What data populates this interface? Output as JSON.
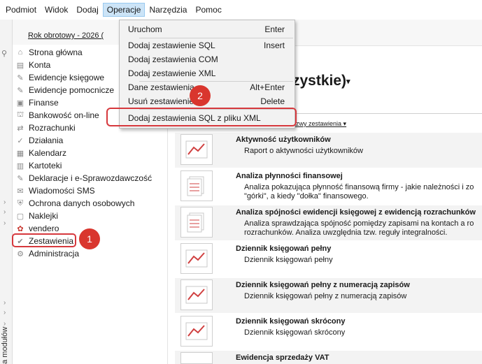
{
  "menubar": {
    "items": [
      "Podmiot",
      "Widok",
      "Dodaj",
      "Operacje",
      "Narzędzia",
      "Pomoc"
    ],
    "active_index": 3
  },
  "top": {
    "rok_label": "Rok obrotowy - 2026  ("
  },
  "left_strip": {
    "label": "Lista modułów"
  },
  "sidebar": {
    "items": [
      {
        "label": "Strona główna",
        "icon": "house-icon"
      },
      {
        "label": "Konta",
        "icon": "accounts-icon"
      },
      {
        "label": "Ewidencje księgowe",
        "icon": "ledger-icon"
      },
      {
        "label": "Ewidencje pomocnicze",
        "icon": "ledger-aux-icon"
      },
      {
        "label": "Finanse",
        "icon": "finance-icon"
      },
      {
        "label": "Bankowość on-line",
        "icon": "bank-icon"
      },
      {
        "label": "Rozrachunki",
        "icon": "settlements-icon"
      },
      {
        "label": "Działania",
        "icon": "actions-icon"
      },
      {
        "label": "Kalendarz",
        "icon": "calendar-icon"
      },
      {
        "label": "Kartoteki",
        "icon": "files-icon"
      },
      {
        "label": "Deklaracje i e-Sprawozdawczość",
        "icon": "declarations-icon"
      },
      {
        "label": "Wiadomości SMS",
        "icon": "sms-icon"
      },
      {
        "label": "Ochrona danych osobowych",
        "icon": "privacy-icon"
      },
      {
        "label": "Naklejki",
        "icon": "sticker-icon"
      },
      {
        "label": "vendero",
        "icon": "vendero-icon"
      },
      {
        "label": "Zestawienia",
        "icon": "reports-icon"
      },
      {
        "label": "Administracja",
        "icon": "admin-icon"
      }
    ]
  },
  "main": {
    "heading": "zystkie)",
    "sort_label": "według nazwy zestawienia ▾",
    "reports": [
      {
        "title": "Aktywność użytkowników",
        "desc": "Raport o aktywności użytkowników"
      },
      {
        "title": "Analiza płynności finansowej",
        "desc": "Analiza pokazująca płynność finansową firmy - jakie należności i zo\n\"górki\", a kiedy \"dołka\" finansowego."
      },
      {
        "title": "Analiza spójności ewidencji księgowej z ewidencją rozrachunków",
        "desc": "Analiza sprawdzająca spójność pomiędzy zapisami na kontach a ro\nrozrachunków. Analiza uwzględnia tzw. reguły integralności."
      },
      {
        "title": "Dziennik księgowań pełny",
        "desc": "Dziennik księgowań pełny"
      },
      {
        "title": "Dziennik księgowań pełny z numeracją zapisów",
        "desc": "Dziennik księgowań pełny z numeracją zapisów"
      },
      {
        "title": "Dziennik księgowań skrócony",
        "desc": "Dziennik księgowań skrócony"
      },
      {
        "title": "Ewidencja sprzedaży VAT",
        "desc": ""
      }
    ]
  },
  "dropdown": {
    "items": [
      {
        "label": "Uruchom",
        "shortcut": "Enter"
      },
      {
        "label": "Dodaj zestawienie SQL",
        "shortcut": "Insert"
      },
      {
        "label": "Dodaj zestawienia COM",
        "shortcut": ""
      },
      {
        "label": "Dodaj zestawienie XML",
        "shortcut": ""
      },
      {
        "label": "Dane zestawienia",
        "shortcut": "Alt+Enter"
      },
      {
        "label": "Usuń zestawienie",
        "shortcut": "Delete"
      },
      {
        "label": "Dodaj zestawienia SQL z pliku XML",
        "shortcut": ""
      }
    ]
  },
  "annotations": {
    "badge1": "1",
    "badge2": "2"
  },
  "colors": {
    "accent_red": "#d6383d",
    "menu_active": "#cce4f7"
  }
}
